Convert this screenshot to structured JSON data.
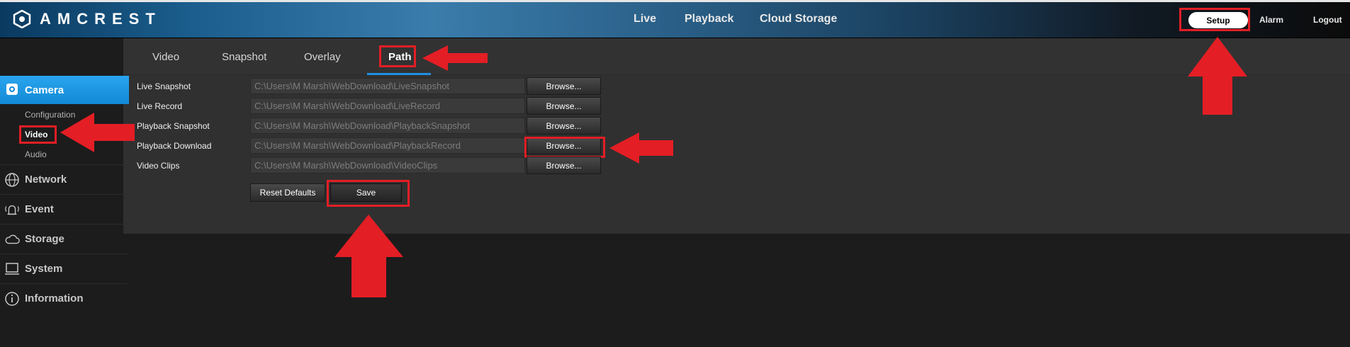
{
  "brand": {
    "logo_text": "AMCREST"
  },
  "top_nav": {
    "live": "Live",
    "playback": "Playback",
    "cloud_storage": "Cloud Storage"
  },
  "top_right": {
    "setup": "Setup",
    "alarm": "Alarm",
    "logout": "Logout"
  },
  "sidebar": {
    "camera": "Camera",
    "camera_sub": [
      "Configuration",
      "Video",
      "Audio"
    ],
    "items": [
      "Network",
      "Event",
      "Storage",
      "System",
      "Information"
    ]
  },
  "tabs": [
    "Video",
    "Snapshot",
    "Overlay",
    "Path"
  ],
  "active_tab": "Path",
  "path_rows": [
    {
      "label": "Live Snapshot",
      "value": "C:\\Users\\M Marsh\\WebDownload\\LiveSnapshot",
      "button": "Browse..."
    },
    {
      "label": "Live Record",
      "value": "C:\\Users\\M Marsh\\WebDownload\\LiveRecord",
      "button": "Browse..."
    },
    {
      "label": "Playback Snapshot",
      "value": "C:\\Users\\M Marsh\\WebDownload\\PlaybackSnapshot",
      "button": "Browse..."
    },
    {
      "label": "Playback Download",
      "value": "C:\\Users\\M Marsh\\WebDownload\\PlaybackRecord",
      "button": "Browse..."
    },
    {
      "label": "Video Clips",
      "value": "C:\\Users\\M Marsh\\WebDownload\\VideoClips",
      "button": "Browse..."
    }
  ],
  "actions": {
    "reset": "Reset Defaults",
    "save": "Save"
  },
  "colors": {
    "accent": "#1e8fe0",
    "annotation": "#e41e25",
    "camera_tab": "#1289d5"
  },
  "icons": [
    "logo-mark-icon",
    "camera-icon",
    "network-icon",
    "event-icon",
    "storage-icon",
    "system-icon",
    "information-icon"
  ]
}
